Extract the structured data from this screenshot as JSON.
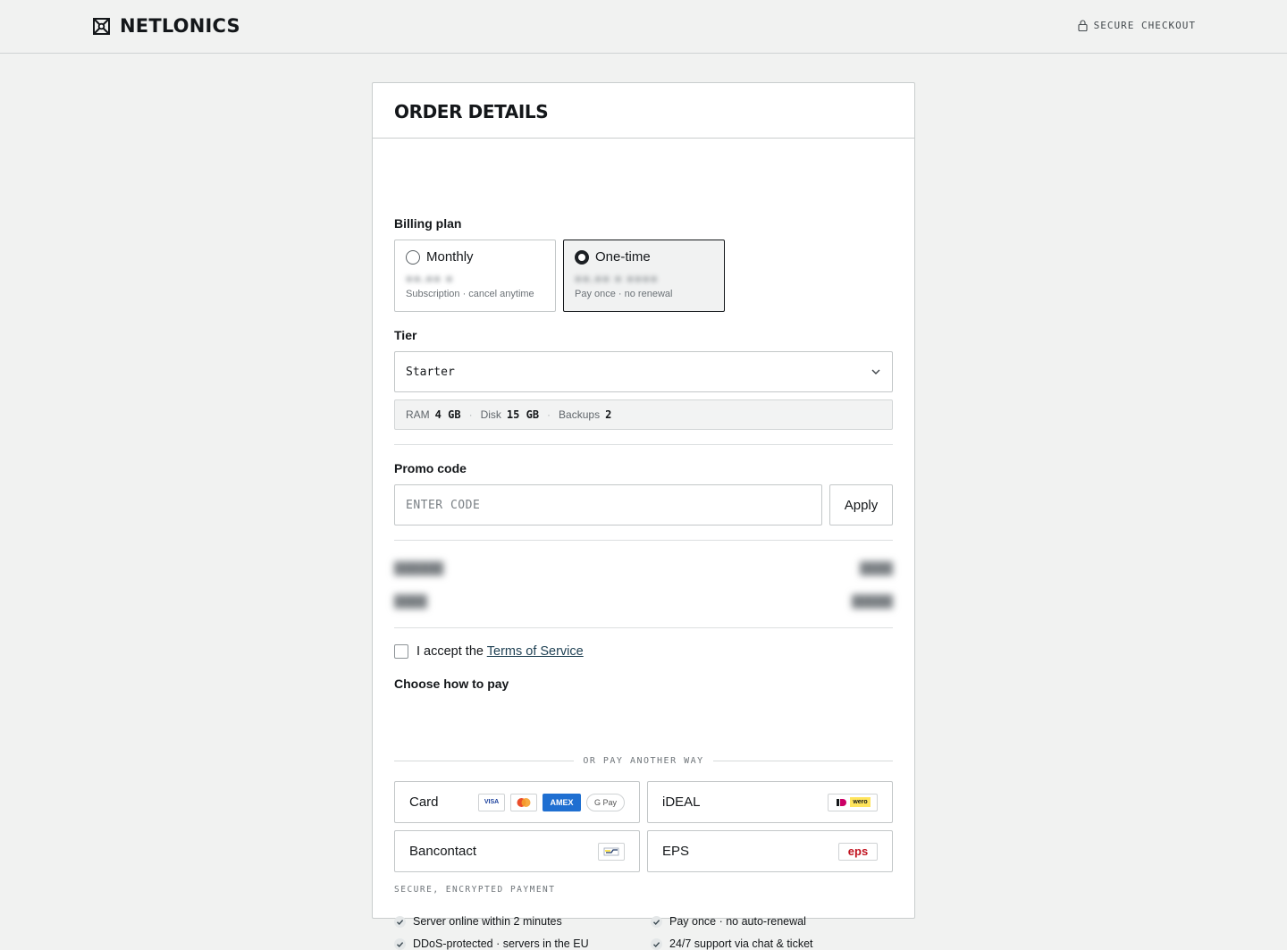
{
  "brand": {
    "name": "NETLONICS"
  },
  "header": {
    "secure_label": "SECURE CHECKOUT"
  },
  "order": {
    "title": "ORDER DETAILS",
    "billing_label": "Billing plan",
    "plans": [
      {
        "name": "Monthly",
        "note": "Subscription · cancel anytime",
        "selected": false
      },
      {
        "name": "One-time",
        "note": "Pay once · no renewal",
        "selected": true
      }
    ],
    "tier_label": "Tier",
    "tier_value": "Starter",
    "specs": {
      "ram_label": "RAM",
      "ram_value": "4 GB",
      "disk_label": "Disk",
      "disk_value": "15 GB",
      "backups_label": "Backups",
      "backups_value": "2"
    },
    "promo_label": "Promo code",
    "promo_placeholder": "ENTER CODE",
    "apply_label": "Apply",
    "terms_prefix": "I accept the",
    "terms_link": "Terms of Service",
    "pay_label": "Choose how to pay",
    "or_label": "OR PAY ANOTHER WAY",
    "methods": [
      {
        "name": "Card",
        "badges": [
          "VISA",
          "mastercard-icon",
          "AMEX",
          "G Pay"
        ]
      },
      {
        "name": "iDEAL",
        "badges": [
          "ideal-wero-icon"
        ]
      },
      {
        "name": "Bancontact",
        "badges": [
          "bancontact-icon"
        ]
      },
      {
        "name": "EPS",
        "badges": [
          "eps"
        ]
      }
    ],
    "secure_note": "SECURE, ENCRYPTED PAYMENT",
    "features": [
      "Server online within 2 minutes",
      "Pay once · no auto-renewal",
      "DDoS-protected · servers in the EU",
      "24/7 support via chat & ticket"
    ]
  },
  "colors": {
    "background": "#f1f2f1",
    "text": "#14171a",
    "selected_border": "#14171a",
    "link": "#1d3f52",
    "amex": "#1f6fd1",
    "eps": "#c1121f",
    "wero": "#ffe45c"
  }
}
